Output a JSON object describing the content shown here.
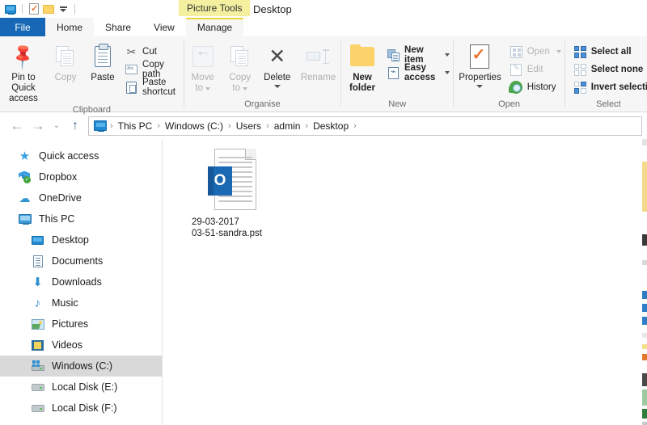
{
  "window": {
    "title": "Desktop",
    "contextual_tools_label": "Picture Tools"
  },
  "quick_access_toolbar": {
    "items": [
      {
        "name": "explorer-icon",
        "label": "This PC"
      },
      {
        "name": "properties-icon",
        "label": "Properties"
      },
      {
        "name": "new-folder-icon",
        "label": "New folder"
      }
    ],
    "customize_label": "Customize Quick Access Toolbar"
  },
  "tabs": [
    {
      "id": "file",
      "label": "File",
      "active": false,
      "style": "file"
    },
    {
      "id": "home",
      "label": "Home",
      "active": true,
      "style": "normal"
    },
    {
      "id": "share",
      "label": "Share",
      "active": false,
      "style": "normal"
    },
    {
      "id": "view",
      "label": "View",
      "active": false,
      "style": "normal"
    },
    {
      "id": "manage",
      "label": "Manage",
      "active": false,
      "style": "contextual"
    }
  ],
  "ribbon": {
    "groups": [
      {
        "id": "clipboard",
        "label": "Clipboard",
        "big_buttons": [
          {
            "id": "pin-to-quick-access",
            "label": "Pin to Quick\naccess",
            "line1": "Pin to Quick",
            "line2": "access",
            "enabled": true
          },
          {
            "id": "copy",
            "label": "Copy",
            "line1": "Copy",
            "line2": "",
            "enabled": false
          },
          {
            "id": "paste",
            "label": "Paste",
            "line1": "Paste",
            "line2": "",
            "enabled": true
          }
        ],
        "small_buttons": [
          {
            "id": "cut",
            "label": "Cut",
            "enabled": true,
            "has_caret": false
          },
          {
            "id": "copy-path",
            "label": "Copy path",
            "enabled": true,
            "has_caret": false
          },
          {
            "id": "paste-shortcut",
            "label": "Paste shortcut",
            "enabled": true,
            "has_caret": false
          }
        ]
      },
      {
        "id": "organise",
        "label": "Organise",
        "big_buttons": [
          {
            "id": "move-to",
            "line1": "Move",
            "line2": "to",
            "enabled": false,
            "has_caret": true
          },
          {
            "id": "copy-to",
            "line1": "Copy",
            "line2": "to",
            "enabled": false,
            "has_caret": true
          },
          {
            "id": "delete",
            "line1": "Delete",
            "line2": "",
            "enabled": true,
            "has_caret": true
          },
          {
            "id": "rename",
            "line1": "Rename",
            "line2": "",
            "enabled": false,
            "has_caret": false
          }
        ],
        "small_buttons": []
      },
      {
        "id": "new",
        "label": "New",
        "big_buttons": [
          {
            "id": "new-folder",
            "line1": "New",
            "line2": "folder",
            "enabled": true
          }
        ],
        "small_buttons": [
          {
            "id": "new-item",
            "label": "New item",
            "enabled": true,
            "has_caret": true
          },
          {
            "id": "easy-access",
            "label": "Easy access",
            "enabled": true,
            "has_caret": true
          }
        ]
      },
      {
        "id": "open",
        "label": "Open",
        "big_buttons": [
          {
            "id": "properties",
            "line1": "Properties",
            "line2": "",
            "enabled": true,
            "has_caret": true
          }
        ],
        "small_buttons": [
          {
            "id": "open",
            "label": "Open",
            "enabled": false,
            "has_caret": true
          },
          {
            "id": "edit",
            "label": "Edit",
            "enabled": false,
            "has_caret": false
          },
          {
            "id": "history",
            "label": "History",
            "enabled": true,
            "has_caret": false
          }
        ]
      },
      {
        "id": "select",
        "label": "Select",
        "big_buttons": [],
        "small_buttons": [
          {
            "id": "select-all",
            "label": "Select all",
            "enabled": true,
            "has_caret": false
          },
          {
            "id": "select-none",
            "label": "Select none",
            "enabled": true,
            "has_caret": false
          },
          {
            "id": "invert-selection",
            "label": "Invert selection",
            "enabled": true,
            "has_caret": false
          }
        ]
      }
    ]
  },
  "address_bar": {
    "back_label": "Back",
    "forward_label": "Forward",
    "recent_label": "Recent locations",
    "up_label": "Up one level",
    "separator": "›",
    "breadcrumbs": [
      {
        "label": "This PC"
      },
      {
        "label": "Windows (C:)"
      },
      {
        "label": "Users"
      },
      {
        "label": "admin"
      },
      {
        "label": "Desktop"
      }
    ]
  },
  "navigation_pane": {
    "items": [
      {
        "id": "quick-access",
        "label": "Quick access",
        "icon": "star-icon",
        "indent": false,
        "selected": false
      },
      {
        "id": "dropbox",
        "label": "Dropbox",
        "icon": "dropbox-icon",
        "indent": false,
        "selected": false
      },
      {
        "id": "onedrive",
        "label": "OneDrive",
        "icon": "cloud-icon",
        "indent": false,
        "selected": false
      },
      {
        "id": "this-pc",
        "label": "This PC",
        "icon": "monitor-icon",
        "indent": false,
        "selected": false
      },
      {
        "id": "desktop",
        "label": "Desktop",
        "icon": "desktop-icon",
        "indent": true,
        "selected": false
      },
      {
        "id": "documents",
        "label": "Documents",
        "icon": "documents-icon",
        "indent": true,
        "selected": false
      },
      {
        "id": "downloads",
        "label": "Downloads",
        "icon": "downloads-icon",
        "indent": true,
        "selected": false
      },
      {
        "id": "music",
        "label": "Music",
        "icon": "music-icon",
        "indent": true,
        "selected": false
      },
      {
        "id": "pictures",
        "label": "Pictures",
        "icon": "pictures-icon",
        "indent": true,
        "selected": false
      },
      {
        "id": "videos",
        "label": "Videos",
        "icon": "videos-icon",
        "indent": true,
        "selected": false
      },
      {
        "id": "windows-c",
        "label": "Windows (C:)",
        "icon": "windows-drive-icon",
        "indent": true,
        "selected": true
      },
      {
        "id": "local-disk-e",
        "label": "Local Disk (E:)",
        "icon": "drive-icon",
        "indent": true,
        "selected": false
      },
      {
        "id": "local-disk-f",
        "label": "Local Disk (F:)",
        "icon": "drive-icon",
        "indent": true,
        "selected": false
      }
    ]
  },
  "content": {
    "files": [
      {
        "id": "pst-file",
        "name_line1": "29-03-2017",
        "name_line2": "03-51-sandra.pst",
        "icon": "outlook-pst-icon",
        "badge_letter": "O",
        "selected": false
      }
    ]
  },
  "colors": {
    "file_tab_blue": "#1667b5",
    "contextual_yellow": "#f4f0a0",
    "contextual_tab_border": "#ead734",
    "ribbon_bg": "#f6f6f6",
    "selection_gray": "#d9d9d9",
    "outlook_blue": "#1b68b3",
    "accent_blue": "#2d8fd0"
  }
}
